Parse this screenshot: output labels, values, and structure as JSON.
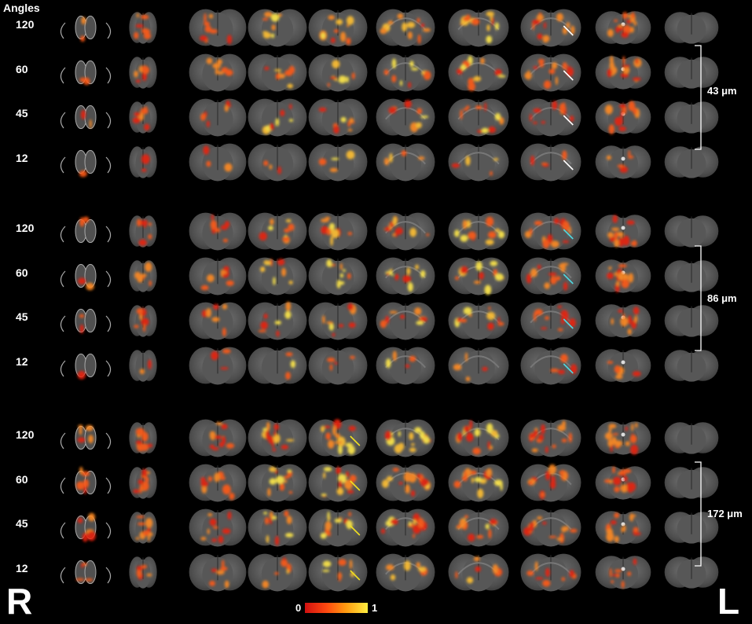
{
  "header": {
    "angles_label": "Angles"
  },
  "groups": [
    {
      "rows": [
        "120",
        "60",
        "45",
        "12"
      ],
      "bracket_label": "43 μm",
      "arrow_color": "#ffffff",
      "arrow_column": 7
    },
    {
      "rows": [
        "120",
        "60",
        "45",
        "12"
      ],
      "bracket_label": "86 μm",
      "arrow_color": "#4fd8e0",
      "arrow_column": 7
    },
    {
      "rows": [
        "120",
        "60",
        "45",
        "12"
      ],
      "bracket_label": "172 μm",
      "arrow_color": "#f0e020",
      "arrow_column": 4
    }
  ],
  "colorbar": {
    "min_label": "0",
    "max_label": "1"
  },
  "orientation": {
    "left": "R",
    "right": "L"
  },
  "colors": {
    "background": "#000000",
    "tissue": "#555555",
    "heat_low": "#d01010",
    "heat_high": "#ffee40"
  }
}
